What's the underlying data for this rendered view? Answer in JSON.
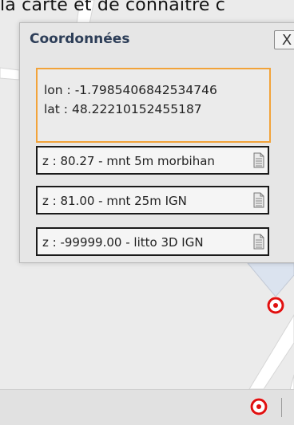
{
  "top_text": "la carte et de connaître c",
  "panel": {
    "title": "Coordonnées",
    "close_label": "X",
    "lon": "lon : -1.7985406842534746",
    "lat": "lat : 48.22210152455187",
    "rows": [
      {
        "text": "z : 80.27 - mnt 5m morbihan"
      },
      {
        "text": "z : 81.00 - mnt 25m IGN"
      },
      {
        "text": "z : -99999.00 - litto 3D IGN"
      }
    ]
  },
  "icons": {
    "document": "document-icon",
    "target": "map-target-icon"
  },
  "colors": {
    "highlight_border": "#f2a33a",
    "target_red": "#e01010",
    "title_text": "#2d3e58"
  }
}
